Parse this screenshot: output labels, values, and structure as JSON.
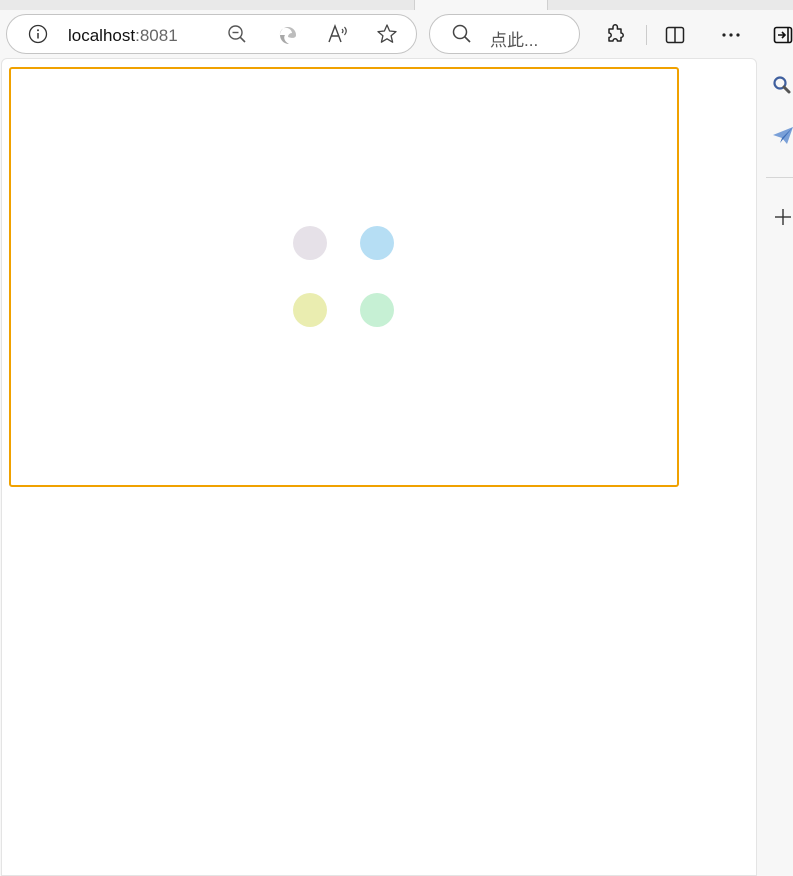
{
  "browser": {
    "address": {
      "host": "localhost",
      "port": ":8081"
    },
    "search": {
      "placeholder": "点此..."
    }
  },
  "loader": {
    "dots": [
      {
        "name": "loader-dot-gray",
        "color": "#e6e1e8"
      },
      {
        "name": "loader-dot-blue",
        "color": "#b6def4"
      },
      {
        "name": "loader-dot-yellow",
        "color": "#eaedb0"
      },
      {
        "name": "loader-dot-green",
        "color": "#c6f0d4"
      }
    ]
  },
  "colors": {
    "frame_border": "#f0a100"
  },
  "icons": {
    "address_bar": [
      "info-icon",
      "zoom-out-icon",
      "edge-logo-icon",
      "read-aloud-icon",
      "favorite-star-icon"
    ],
    "search_bar": [
      "search-icon"
    ],
    "toolbar": [
      "extensions-icon",
      "split-screen-icon",
      "more-menu-icon",
      "sidebar-toggle-icon"
    ],
    "sidebar": [
      "sidebar-search-icon",
      "sidebar-send-icon",
      "sidebar-add-icon"
    ]
  }
}
